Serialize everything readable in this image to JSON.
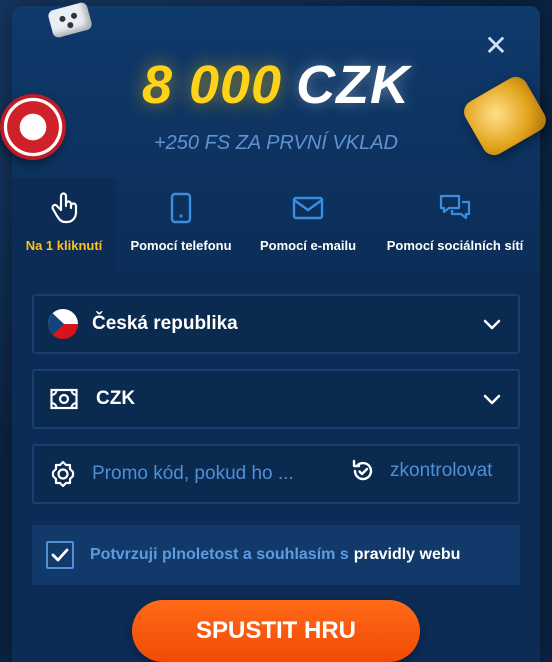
{
  "bonus": {
    "amount": "8 000",
    "currency": "CZK",
    "free_spins": "+250 FS ZA PRVNÍ VKLAD"
  },
  "close_icon": "close-icon",
  "tabs": [
    {
      "label": "Na 1 kliknutí",
      "icon": "hand-pointer-icon",
      "active": true
    },
    {
      "label": "Pomocí telefonu",
      "icon": "phone-icon",
      "active": false
    },
    {
      "label": "Pomocí e-mailu",
      "icon": "envelope-icon",
      "active": false
    },
    {
      "label": "Pomocí sociálních sítí",
      "icon": "chat-bubbles-icon",
      "active": false
    }
  ],
  "form": {
    "country": {
      "value": "Česká republika",
      "flag": "czech-flag-icon"
    },
    "currency": {
      "value": "CZK",
      "icon": "banknote-icon"
    },
    "promo": {
      "placeholder": "Promo kód, pokud ho ...",
      "check_label": "zkontrolovat"
    },
    "terms": {
      "text": "Potvrzuji plnoletost a souhlasím s",
      "link": "pravidly webu",
      "checked": true
    },
    "submit": "SPUSTIT HRU"
  },
  "colors": {
    "accent_gold": "#ffd21a",
    "active_tab": "#ffc21a",
    "button": "#f24a06",
    "link_blue": "#4f8fd6"
  }
}
